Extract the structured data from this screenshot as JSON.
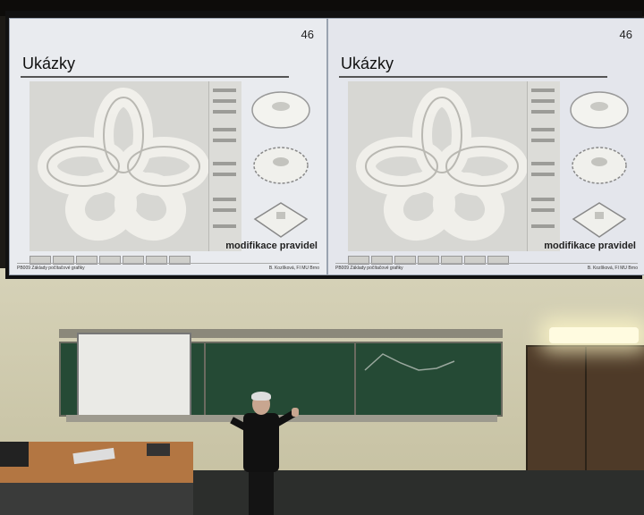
{
  "slides": [
    {
      "number": "46",
      "title": "Ukázky",
      "caption": "modifikace pravidel",
      "footer_left": "PB009 Základy počítačové grafiky",
      "footer_right": "B. Kozlíková, FI MU Brno"
    },
    {
      "number": "46",
      "title": "Ukázky",
      "caption": "modifikace pravidel",
      "footer_left": "PB009 Základy počítačové grafiky",
      "footer_right": "B. Kozlíková, FI MU Brno"
    }
  ],
  "colors": {
    "slide_bg": "#e9ebef",
    "chalkboard": "#254a35",
    "wall": "#d6d2b8",
    "desk": "#b37642",
    "door": "#4e3a28"
  }
}
